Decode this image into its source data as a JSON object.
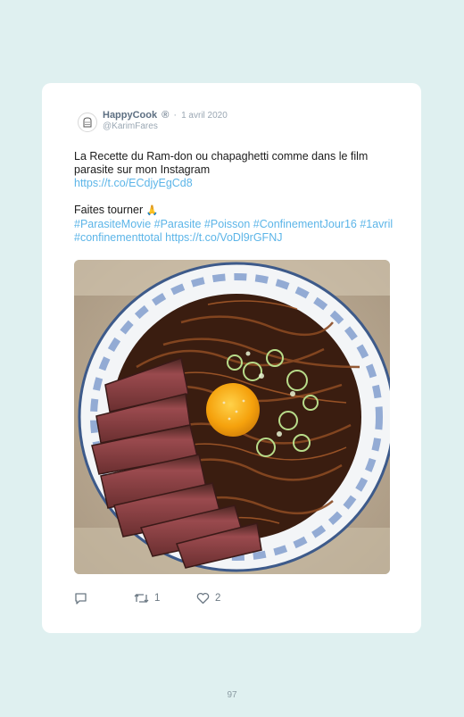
{
  "tweet": {
    "display_name": "HappyCook",
    "badge": "®",
    "separator": "·",
    "date": "1 avril 2020",
    "handle": "@KarimFares",
    "line1": "La Recette du Ram-don ou chapaghetti comme dans le film parasite sur mon Instagram",
    "link1": "https://t.co/ECdjyEgCd8",
    "line2": "Faites tourner",
    "emoji": "🙏",
    "hashtags": "#ParasiteMovie #Parasite #Poisson #ConfinementJour16 #1avril #confinementtotal",
    "link2": "https://t.co/VoDl9rGFNJ",
    "avatar_text": "HAPPY COOK"
  },
  "actions": {
    "reply_count": "",
    "retweet_count": "1",
    "like_count": "2"
  },
  "page_number": "97",
  "icons": [
    "reply-icon",
    "retweet-icon",
    "heart-icon"
  ]
}
